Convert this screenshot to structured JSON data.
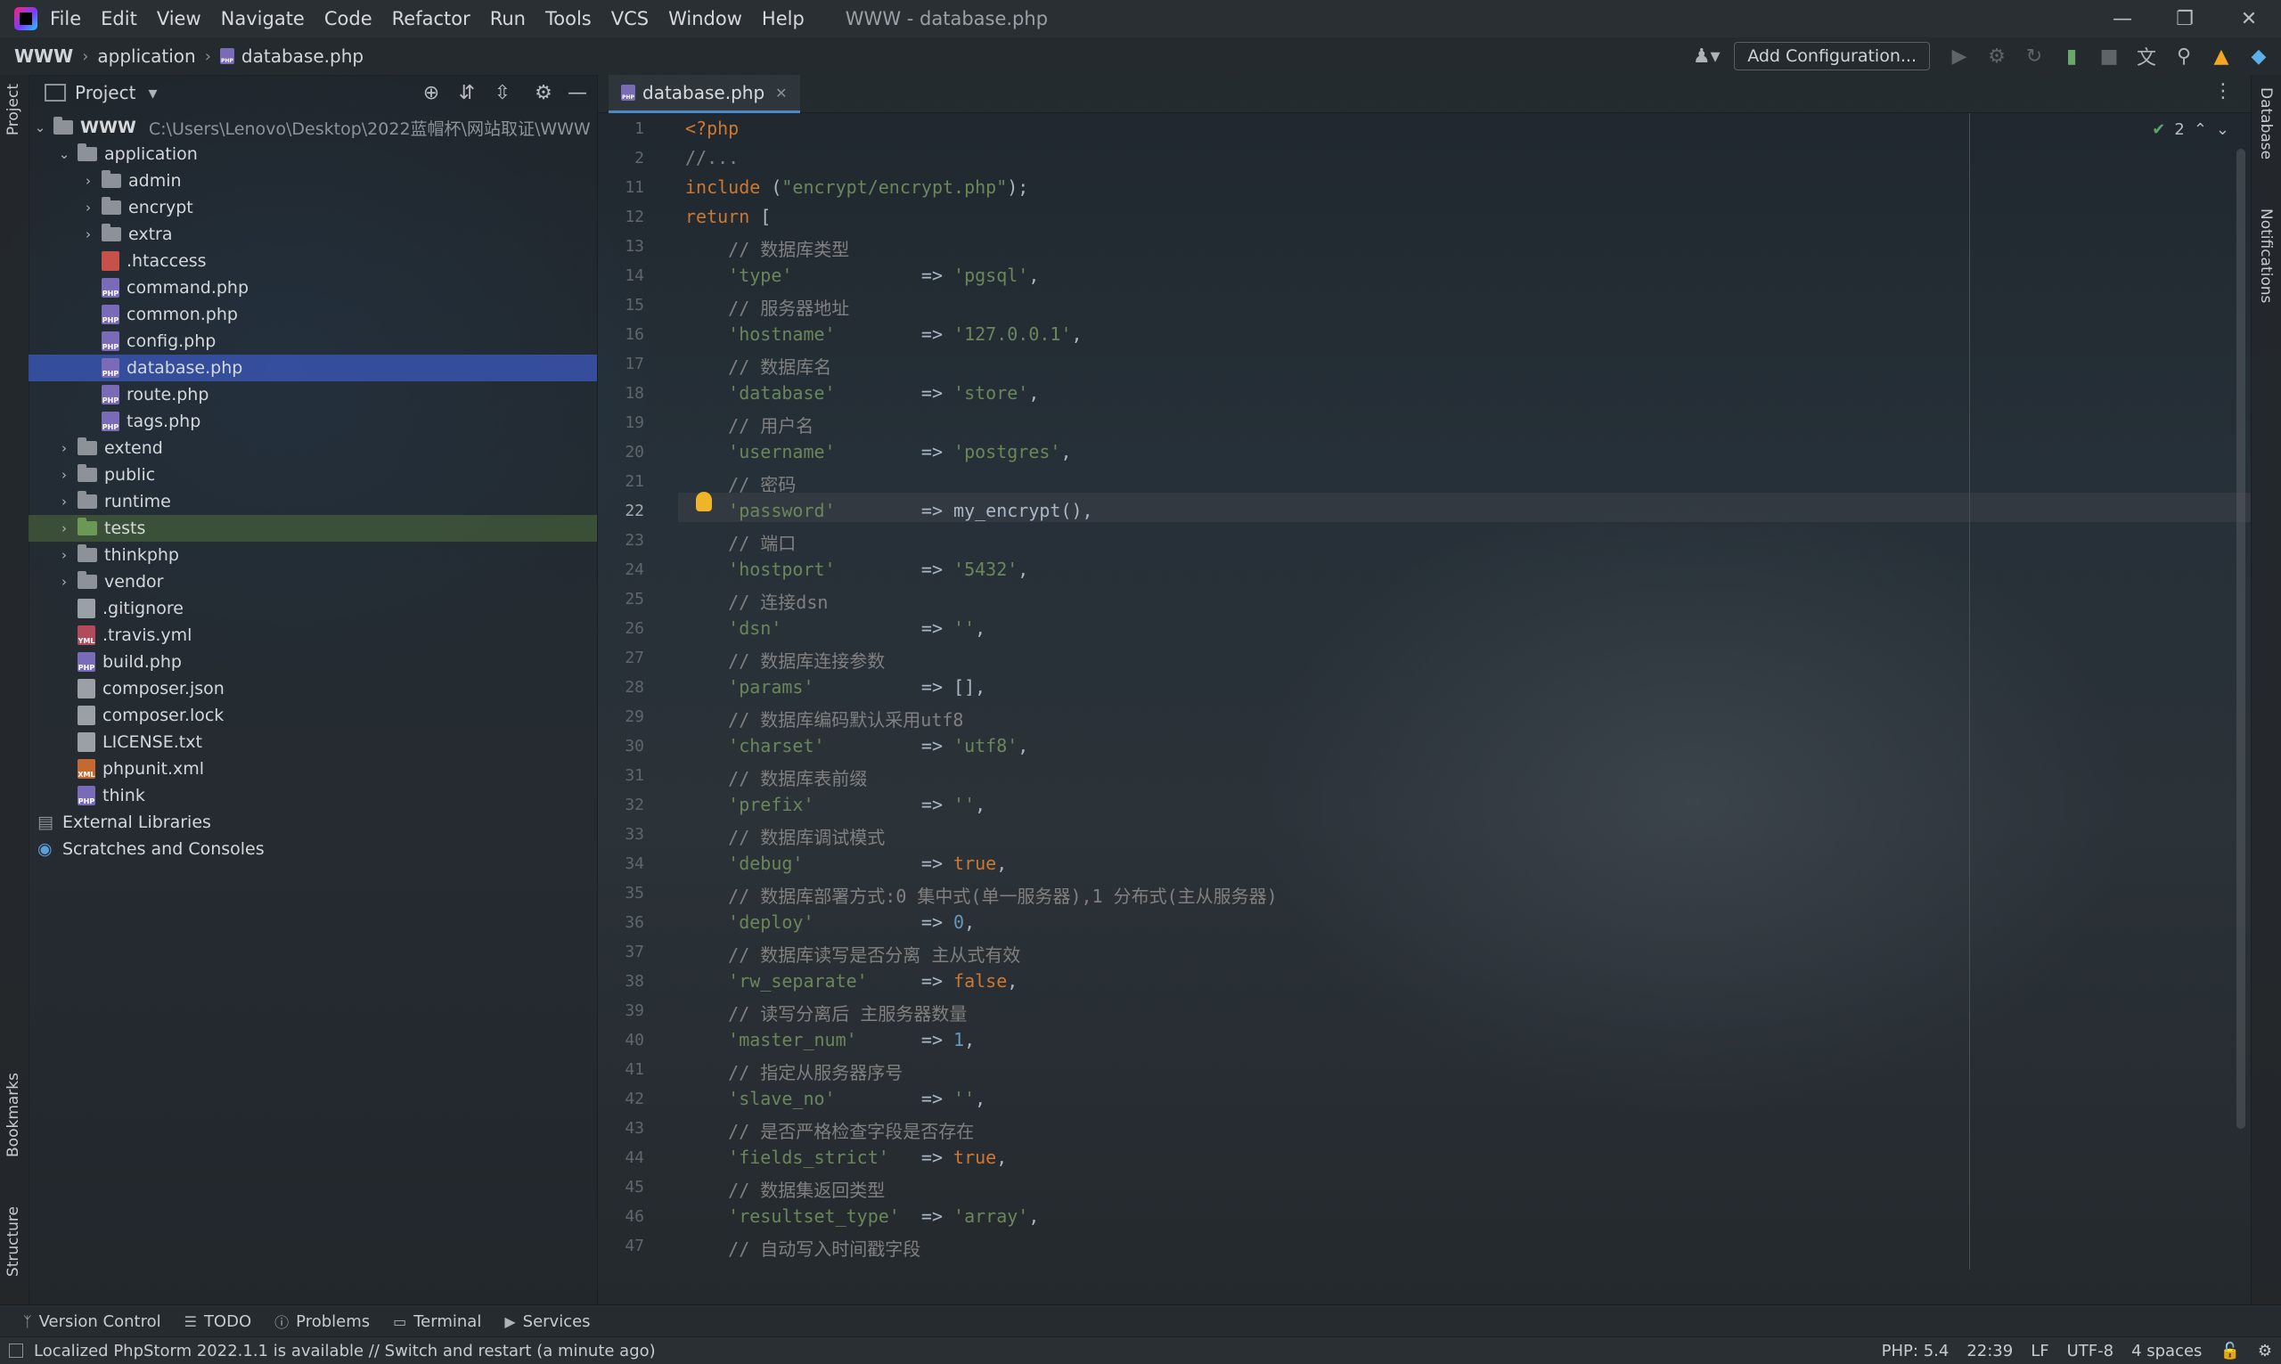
{
  "app": {
    "title": "WWW - database.php"
  },
  "menu": [
    "File",
    "Edit",
    "View",
    "Navigate",
    "Code",
    "Refactor",
    "Run",
    "Tools",
    "VCS",
    "Window",
    "Help"
  ],
  "breadcrumb": [
    "WWW",
    "application",
    "database.php"
  ],
  "toolbar": {
    "add_config": "Add Configuration..."
  },
  "project_panel": {
    "title": "Project",
    "root": {
      "name": "WWW",
      "path": "C:\\Users\\Lenovo\\Desktop\\2022蓝帽杯\\网站取证\\WWW"
    },
    "items": [
      {
        "label": "application",
        "type": "folder",
        "level": 1,
        "expanded": true
      },
      {
        "label": "admin",
        "type": "folder",
        "level": 2
      },
      {
        "label": "encrypt",
        "type": "folder",
        "level": 2
      },
      {
        "label": "extra",
        "type": "folder",
        "level": 2
      },
      {
        "label": ".htaccess",
        "type": "htaccess",
        "level": 2
      },
      {
        "label": "command.php",
        "type": "php",
        "level": 2
      },
      {
        "label": "common.php",
        "type": "php",
        "level": 2
      },
      {
        "label": "config.php",
        "type": "php",
        "level": 2
      },
      {
        "label": "database.php",
        "type": "php",
        "level": 2,
        "selected": true
      },
      {
        "label": "route.php",
        "type": "php",
        "level": 2
      },
      {
        "label": "tags.php",
        "type": "php",
        "level": 2
      },
      {
        "label": "extend",
        "type": "folder",
        "level": 1
      },
      {
        "label": "public",
        "type": "folder",
        "level": 1
      },
      {
        "label": "runtime",
        "type": "folder",
        "level": 1
      },
      {
        "label": "tests",
        "type": "folder-green",
        "level": 1
      },
      {
        "label": "thinkphp",
        "type": "folder",
        "level": 1
      },
      {
        "label": "vendor",
        "type": "folder",
        "level": 1
      },
      {
        "label": ".gitignore",
        "type": "gen",
        "level": 1,
        "noarrow": true
      },
      {
        "label": ".travis.yml",
        "type": "yml",
        "level": 1,
        "noarrow": true
      },
      {
        "label": "build.php",
        "type": "php",
        "level": 1,
        "noarrow": true
      },
      {
        "label": "composer.json",
        "type": "gen",
        "level": 1,
        "noarrow": true
      },
      {
        "label": "composer.lock",
        "type": "gen",
        "level": 1,
        "noarrow": true
      },
      {
        "label": "LICENSE.txt",
        "type": "gen",
        "level": 1,
        "noarrow": true
      },
      {
        "label": "phpunit.xml",
        "type": "xml",
        "level": 1,
        "noarrow": true
      },
      {
        "label": "think",
        "type": "php",
        "level": 1,
        "noarrow": true
      }
    ],
    "extras": [
      "External Libraries",
      "Scratches and Consoles"
    ]
  },
  "editor": {
    "tab": "database.php",
    "inspection_count": "2",
    "lines": [
      {
        "n": "1",
        "html": "<span class='tag'>&lt;?php</span>"
      },
      {
        "n": "2",
        "html": "<span class='cm'>//...</span>"
      },
      {
        "n": "11",
        "html": "<span class='kw'>include</span> (<span class='str'>\"encrypt/encrypt.php\"</span>);"
      },
      {
        "n": "12",
        "html": "<span class='kw'>return</span> ["
      },
      {
        "n": "13",
        "html": "    <span class='cm'>// 数据库类型</span>"
      },
      {
        "n": "14",
        "html": "    <span class='str'>'type'</span>            => <span class='str'>'pgsql'</span>,"
      },
      {
        "n": "15",
        "html": "    <span class='cm'>// 服务器地址</span>"
      },
      {
        "n": "16",
        "html": "    <span class='str'>'hostname'</span>        => <span class='str'>'127.0.0.1'</span>,"
      },
      {
        "n": "17",
        "html": "    <span class='cm'>// 数据库名</span>"
      },
      {
        "n": "18",
        "html": "    <span class='str'>'database'</span>        => <span class='str'>'store'</span>,"
      },
      {
        "n": "19",
        "html": "    <span class='cm'>// 用户名</span>"
      },
      {
        "n": "20",
        "html": "    <span class='str'>'username'</span>        => <span class='str'>'postgres'</span>,"
      },
      {
        "n": "21",
        "html": "    <span class='cm'>// 密码</span>"
      },
      {
        "n": "22",
        "html": "    <span class='str'>'password'</span>        => <span class='plain'>my_encrypt</span>(),"
      },
      {
        "n": "23",
        "html": "    <span class='cm'>// 端口</span>"
      },
      {
        "n": "24",
        "html": "    <span class='str'>'hostport'</span>        => <span class='str'>'5432'</span>,"
      },
      {
        "n": "25",
        "html": "    <span class='cm'>// 连接dsn</span>"
      },
      {
        "n": "26",
        "html": "    <span class='str'>'dsn'</span>             => <span class='str'>''</span>,"
      },
      {
        "n": "27",
        "html": "    <span class='cm'>// 数据库连接参数</span>"
      },
      {
        "n": "28",
        "html": "    <span class='str'>'params'</span>          => [],"
      },
      {
        "n": "29",
        "html": "    <span class='cm'>// 数据库编码默认采用utf8</span>"
      },
      {
        "n": "30",
        "html": "    <span class='str'>'charset'</span>         => <span class='str'>'utf8'</span>,"
      },
      {
        "n": "31",
        "html": "    <span class='cm'>// 数据库表前缀</span>"
      },
      {
        "n": "32",
        "html": "    <span class='str'>'prefix'</span>          => <span class='str'>''</span>,"
      },
      {
        "n": "33",
        "html": "    <span class='cm'>// 数据库调试模式</span>"
      },
      {
        "n": "34",
        "html": "    <span class='str'>'debug'</span>           => <span class='kw'>true</span>,"
      },
      {
        "n": "35",
        "html": "    <span class='cm'>// 数据库部署方式:0 集中式(单一服务器),1 分布式(主从服务器)</span>"
      },
      {
        "n": "36",
        "html": "    <span class='str'>'deploy'</span>          => <span class='num'>0</span>,"
      },
      {
        "n": "37",
        "html": "    <span class='cm'>// 数据库读写是否分离 主从式有效</span>"
      },
      {
        "n": "38",
        "html": "    <span class='str'>'rw_separate'</span>     => <span class='kw'>false</span>,"
      },
      {
        "n": "39",
        "html": "    <span class='cm'>// 读写分离后 主服务器数量</span>"
      },
      {
        "n": "40",
        "html": "    <span class='str'>'master_num'</span>      => <span class='num'>1</span>,"
      },
      {
        "n": "41",
        "html": "    <span class='cm'>// 指定从服务器序号</span>"
      },
      {
        "n": "42",
        "html": "    <span class='str'>'slave_no'</span>        => <span class='str'>''</span>,"
      },
      {
        "n": "43",
        "html": "    <span class='cm'>// 是否严格检查字段是否存在</span>"
      },
      {
        "n": "44",
        "html": "    <span class='str'>'fields_strict'</span>   => <span class='kw'>true</span>,"
      },
      {
        "n": "45",
        "html": "    <span class='cm'>// 数据集返回类型</span>"
      },
      {
        "n": "46",
        "html": "    <span class='str'>'resultset_type'</span>  => <span class='str'>'array'</span>,"
      },
      {
        "n": "47",
        "html": "    <span class='cm'>// 自动写入时间戳字段</span>"
      }
    ]
  },
  "left_stripe": [
    "Project",
    "Bookmarks",
    "Structure"
  ],
  "right_stripe": [
    "Database",
    "Notifications"
  ],
  "bottom_tools": [
    "Version Control",
    "TODO",
    "Problems",
    "Terminal",
    "Services"
  ],
  "status": {
    "message": "Localized PhpStorm 2022.1.1 is available // Switch and restart (a minute ago)",
    "php": "PHP: 5.4",
    "position": "22:39",
    "line_sep": "LF",
    "encoding": "UTF-8",
    "indent": "4 spaces"
  }
}
